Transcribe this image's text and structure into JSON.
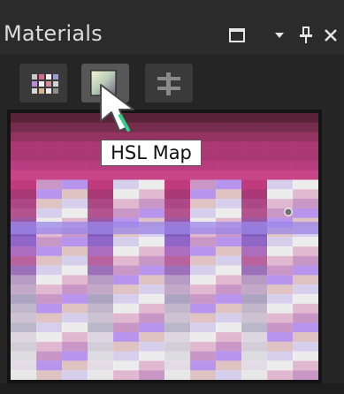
{
  "panel": {
    "title": "Materials",
    "controls": [
      "maximize-icon",
      "dropdown-icon",
      "pin-icon",
      "close-icon"
    ],
    "tabs": [
      {
        "name": "swatches",
        "icon": "swatches-grid-icon",
        "active": false
      },
      {
        "name": "hsl-map",
        "icon": "hsl-gradient-icon",
        "active": true
      },
      {
        "name": "sliders",
        "icon": "sliders-icon",
        "active": false
      }
    ]
  },
  "tooltip": {
    "text": "HSL Map"
  },
  "colors": {
    "title_bg": "#2b2b2b",
    "panel_bg": "#252525",
    "button_bg": "#3a3a3a",
    "button_active_bg": "#575757",
    "text": "#dcdcdc",
    "tooltip_bg": "#ffffff",
    "cursor_outline": "#2fd18c"
  }
}
